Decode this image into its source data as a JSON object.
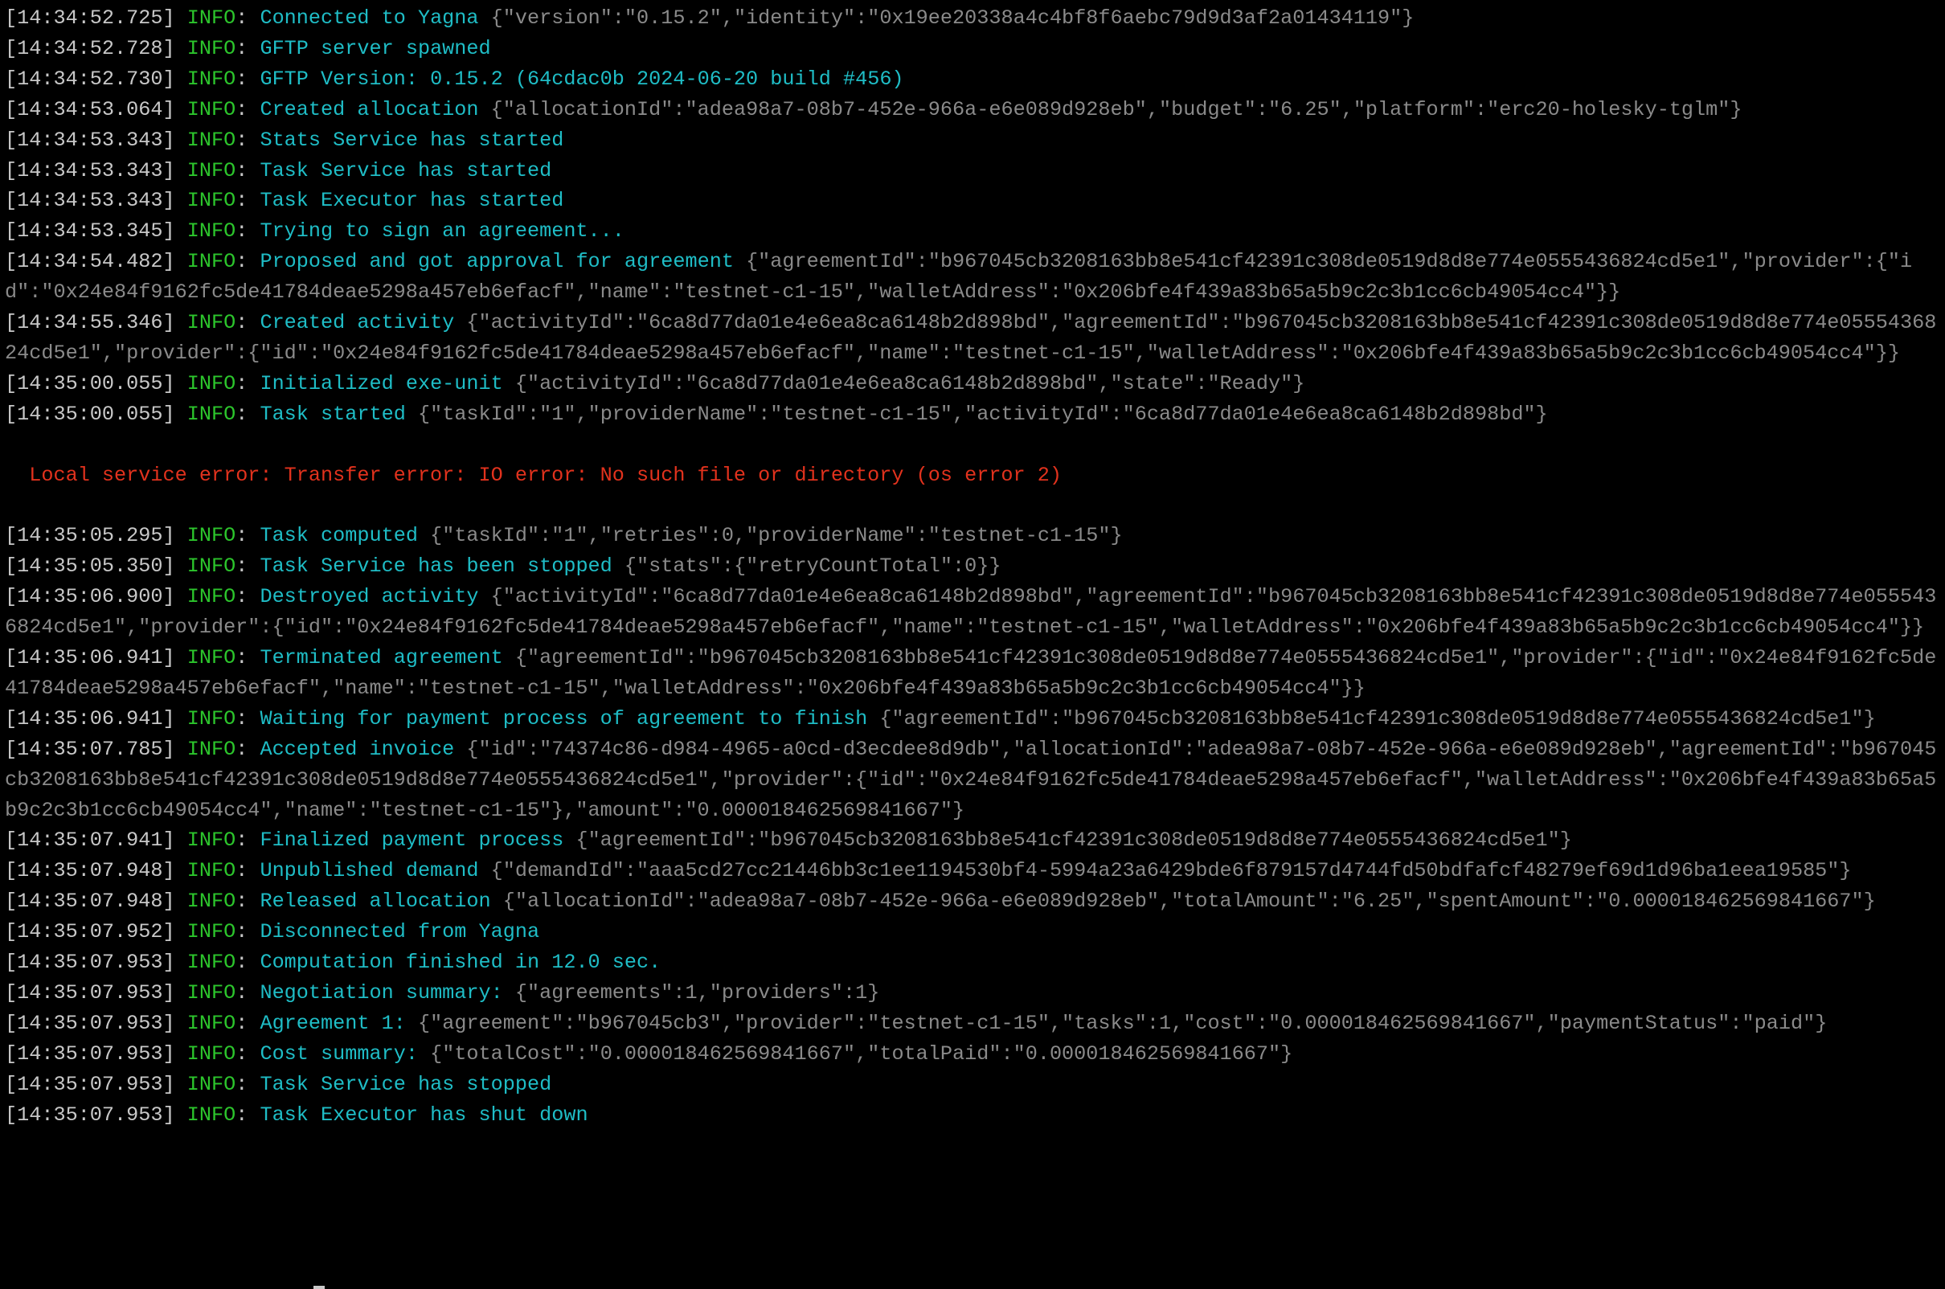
{
  "terminal": {
    "colors": {
      "timestamp": "#c8c8c8",
      "level": "#2cc52c",
      "message": "#1fbdc6",
      "json": "#8a8a8a",
      "error": "#e2321d",
      "background": "#000000"
    },
    "lines": [
      {
        "type": "log",
        "ts": "[14:34:52.725]",
        "level": "INFO",
        "msg": "Connected to Yagna",
        "json": "{\"version\":\"0.15.2\",\"identity\":\"0x19ee20338a4c4bf8f6aebc79d9d3af2a01434119\"}"
      },
      {
        "type": "log",
        "ts": "[14:34:52.728]",
        "level": "INFO",
        "msg": "GFTP server spawned",
        "json": ""
      },
      {
        "type": "log",
        "ts": "[14:34:52.730]",
        "level": "INFO",
        "msg": "GFTP Version: 0.15.2 (64cdac0b 2024-06-20 build #456)",
        "json": ""
      },
      {
        "type": "log",
        "ts": "[14:34:53.064]",
        "level": "INFO",
        "msg": "Created allocation",
        "json": "{\"allocationId\":\"adea98a7-08b7-452e-966a-e6e089d928eb\",\"budget\":\"6.25\",\"platform\":\"erc20-holesky-tglm\"}"
      },
      {
        "type": "log",
        "ts": "[14:34:53.343]",
        "level": "INFO",
        "msg": "Stats Service has started",
        "json": ""
      },
      {
        "type": "log",
        "ts": "[14:34:53.343]",
        "level": "INFO",
        "msg": "Task Service has started",
        "json": ""
      },
      {
        "type": "log",
        "ts": "[14:34:53.343]",
        "level": "INFO",
        "msg": "Task Executor has started",
        "json": ""
      },
      {
        "type": "log",
        "ts": "[14:34:53.345]",
        "level": "INFO",
        "msg": "Trying to sign an agreement...",
        "json": ""
      },
      {
        "type": "log",
        "ts": "[14:34:54.482]",
        "level": "INFO",
        "msg": "Proposed and got approval for agreement",
        "json": "{\"agreementId\":\"b967045cb3208163bb8e541cf42391c308de0519d8d8e774e0555436824cd5e1\",\"provider\":{\"id\":\"0x24e84f9162fc5de41784deae5298a457eb6efacf\",\"name\":\"testnet-c1-15\",\"walletAddress\":\"0x206bfe4f439a83b65a5b9c2c3b1cc6cb49054cc4\"}}"
      },
      {
        "type": "log",
        "ts": "[14:34:55.346]",
        "level": "INFO",
        "msg": "Created activity",
        "json": "{\"activityId\":\"6ca8d77da01e4e6ea8ca6148b2d898bd\",\"agreementId\":\"b967045cb3208163bb8e541cf42391c308de0519d8d8e774e0555436824cd5e1\",\"provider\":{\"id\":\"0x24e84f9162fc5de41784deae5298a457eb6efacf\",\"name\":\"testnet-c1-15\",\"walletAddress\":\"0x206bfe4f439a83b65a5b9c2c3b1cc6cb49054cc4\"}}"
      },
      {
        "type": "log",
        "ts": "[14:35:00.055]",
        "level": "INFO",
        "msg": "Initialized exe-unit",
        "json": "{\"activityId\":\"6ca8d77da01e4e6ea8ca6148b2d898bd\",\"state\":\"Ready\"}"
      },
      {
        "type": "log",
        "ts": "[14:35:00.055]",
        "level": "INFO",
        "msg": "Task started",
        "json": "{\"taskId\":\"1\",\"providerName\":\"testnet-c1-15\",\"activityId\":\"6ca8d77da01e4e6ea8ca6148b2d898bd\"}"
      },
      {
        "type": "blank"
      },
      {
        "type": "error",
        "text": "  Local service error: Transfer error: IO error: No such file or directory (os error 2)"
      },
      {
        "type": "blank"
      },
      {
        "type": "log",
        "ts": "[14:35:05.295]",
        "level": "INFO",
        "msg": "Task computed",
        "json": "{\"taskId\":\"1\",\"retries\":0,\"providerName\":\"testnet-c1-15\"}"
      },
      {
        "type": "log",
        "ts": "[14:35:05.350]",
        "level": "INFO",
        "msg": "Task Service has been stopped",
        "json": "{\"stats\":{\"retryCountTotal\":0}}"
      },
      {
        "type": "log",
        "ts": "[14:35:06.900]",
        "level": "INFO",
        "msg": "Destroyed activity",
        "json": "{\"activityId\":\"6ca8d77da01e4e6ea8ca6148b2d898bd\",\"agreementId\":\"b967045cb3208163bb8e541cf42391c308de0519d8d8e774e0555436824cd5e1\",\"provider\":{\"id\":\"0x24e84f9162fc5de41784deae5298a457eb6efacf\",\"name\":\"testnet-c1-15\",\"walletAddress\":\"0x206bfe4f439a83b65a5b9c2c3b1cc6cb49054cc4\"}}"
      },
      {
        "type": "log",
        "ts": "[14:35:06.941]",
        "level": "INFO",
        "msg": "Terminated agreement",
        "json": "{\"agreementId\":\"b967045cb3208163bb8e541cf42391c308de0519d8d8e774e0555436824cd5e1\",\"provider\":{\"id\":\"0x24e84f9162fc5de41784deae5298a457eb6efacf\",\"name\":\"testnet-c1-15\",\"walletAddress\":\"0x206bfe4f439a83b65a5b9c2c3b1cc6cb49054cc4\"}}"
      },
      {
        "type": "log",
        "ts": "[14:35:06.941]",
        "level": "INFO",
        "msg": "Waiting for payment process of agreement to finish",
        "json": "{\"agreementId\":\"b967045cb3208163bb8e541cf42391c308de0519d8d8e774e0555436824cd5e1\"}"
      },
      {
        "type": "log",
        "ts": "[14:35:07.785]",
        "level": "INFO",
        "msg": "Accepted invoice",
        "json": "{\"id\":\"74374c86-d984-4965-a0cd-d3ecdee8d9db\",\"allocationId\":\"adea98a7-08b7-452e-966a-e6e089d928eb\",\"agreementId\":\"b967045cb3208163bb8e541cf42391c308de0519d8d8e774e0555436824cd5e1\",\"provider\":{\"id\":\"0x24e84f9162fc5de41784deae5298a457eb6efacf\",\"walletAddress\":\"0x206bfe4f439a83b65a5b9c2c3b1cc6cb49054cc4\",\"name\":\"testnet-c1-15\"},\"amount\":\"0.000018462569841667\"}"
      },
      {
        "type": "log",
        "ts": "[14:35:07.941]",
        "level": "INFO",
        "msg": "Finalized payment process",
        "json": "{\"agreementId\":\"b967045cb3208163bb8e541cf42391c308de0519d8d8e774e0555436824cd5e1\"}"
      },
      {
        "type": "log",
        "ts": "[14:35:07.948]",
        "level": "INFO",
        "msg": "Unpublished demand",
        "json": "{\"demandId\":\"aaa5cd27cc21446bb3c1ee1194530bf4-5994a23a6429bde6f879157d4744fd50bdfafcf48279ef69d1d96ba1eea19585\"}"
      },
      {
        "type": "log",
        "ts": "[14:35:07.948]",
        "level": "INFO",
        "msg": "Released allocation",
        "json": "{\"allocationId\":\"adea98a7-08b7-452e-966a-e6e089d928eb\",\"totalAmount\":\"6.25\",\"spentAmount\":\"0.000018462569841667\"}"
      },
      {
        "type": "log",
        "ts": "[14:35:07.952]",
        "level": "INFO",
        "msg": "Disconnected from Yagna",
        "json": ""
      },
      {
        "type": "log",
        "ts": "[14:35:07.953]",
        "level": "INFO",
        "msg": "Computation finished in 12.0 sec.",
        "json": ""
      },
      {
        "type": "log",
        "ts": "[14:35:07.953]",
        "level": "INFO",
        "msg": "Negotiation summary:",
        "json": "{\"agreements\":1,\"providers\":1}"
      },
      {
        "type": "log",
        "ts": "[14:35:07.953]",
        "level": "INFO",
        "msg": "Agreement 1:",
        "json": "{\"agreement\":\"b967045cb3\",\"provider\":\"testnet-c1-15\",\"tasks\":1,\"cost\":\"0.000018462569841667\",\"paymentStatus\":\"paid\"}"
      },
      {
        "type": "log",
        "ts": "[14:35:07.953]",
        "level": "INFO",
        "msg": "Cost summary:",
        "json": "{\"totalCost\":\"0.000018462569841667\",\"totalPaid\":\"0.000018462569841667\"}"
      },
      {
        "type": "log",
        "ts": "[14:35:07.953]",
        "level": "INFO",
        "msg": "Task Service has stopped",
        "json": ""
      },
      {
        "type": "log",
        "ts": "[14:35:07.953]",
        "level": "INFO",
        "msg": "Task Executor has shut down",
        "json": ""
      }
    ]
  }
}
